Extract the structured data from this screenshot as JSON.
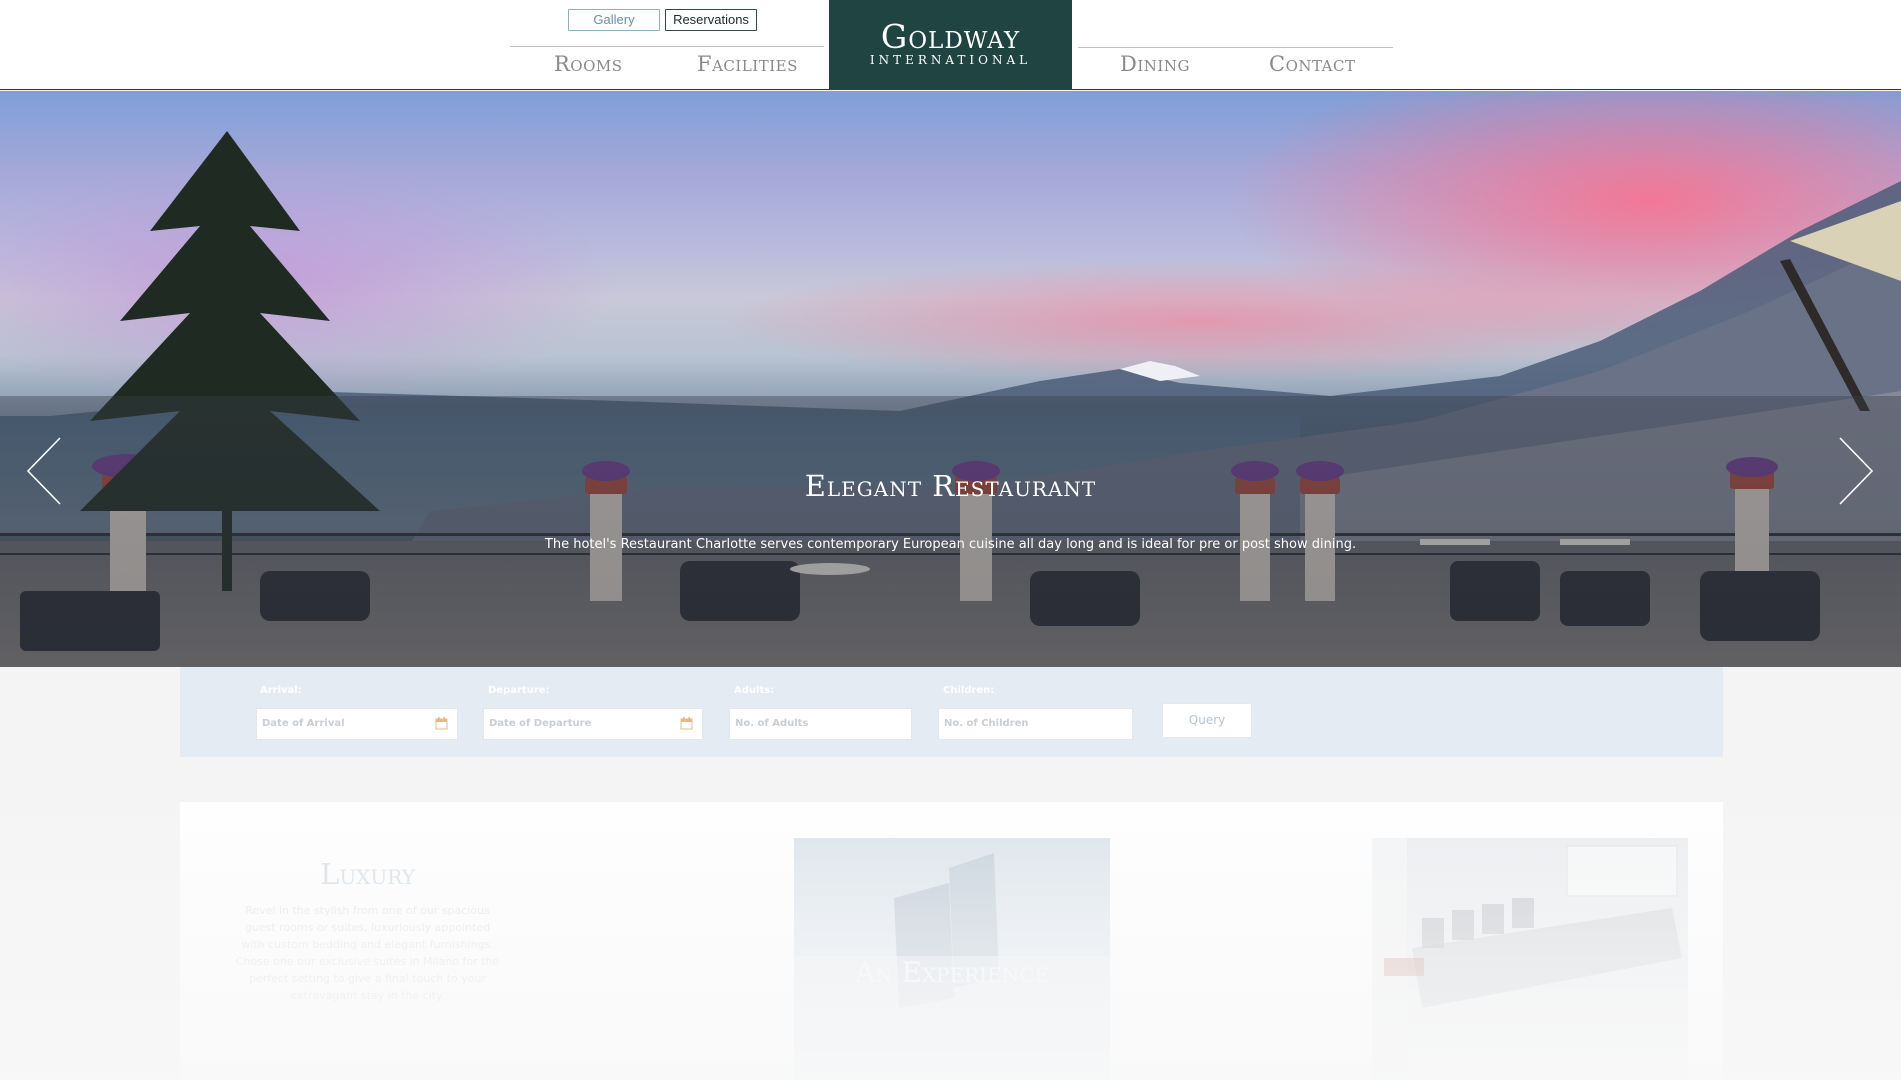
{
  "header": {
    "gallery_label": "Gallery",
    "reservations_label": "Reservations",
    "nav": {
      "rooms": "Rooms",
      "facilities": "Facilities",
      "dining": "Dining",
      "contact": "Contact"
    },
    "logo": {
      "name": "Goldway",
      "subtitle": "INTERNATIONAL"
    }
  },
  "hero": {
    "title": "Elegant Restaurant",
    "description": "The hotel's Restaurant Charlotte serves contemporary European cuisine all day long and is ideal for pre or post show dining.",
    "prev_icon": "chevron-left-icon",
    "next_icon": "chevron-right-icon"
  },
  "booking": {
    "arrival_label": "Arrival:",
    "arrival_placeholder": "Date of Arrival",
    "departure_label": "Departure:",
    "departure_placeholder": "Date of Departure",
    "adults_label": "Adults:",
    "adults_placeholder": "No. of Adults",
    "children_label": "Children:",
    "children_placeholder": "No. of Children",
    "query_label": "Query",
    "calendar_icon": "calendar-icon"
  },
  "features": {
    "luxury_title": "Luxury",
    "luxury_text": "Revel in the stylish from one of our spacious guest rooms or suites, luxuriously appointed with custom bedding and elegant furnishings. Chose one our exclusive suites in Milano for the perfect setting to give a final touch to your extravagant stay in the city.",
    "experience_title": "An Experience"
  },
  "colors": {
    "logo_bg": "#1f4442",
    "nav_text": "#8a8a8a",
    "booking_bg": "#e4ebf2"
  }
}
